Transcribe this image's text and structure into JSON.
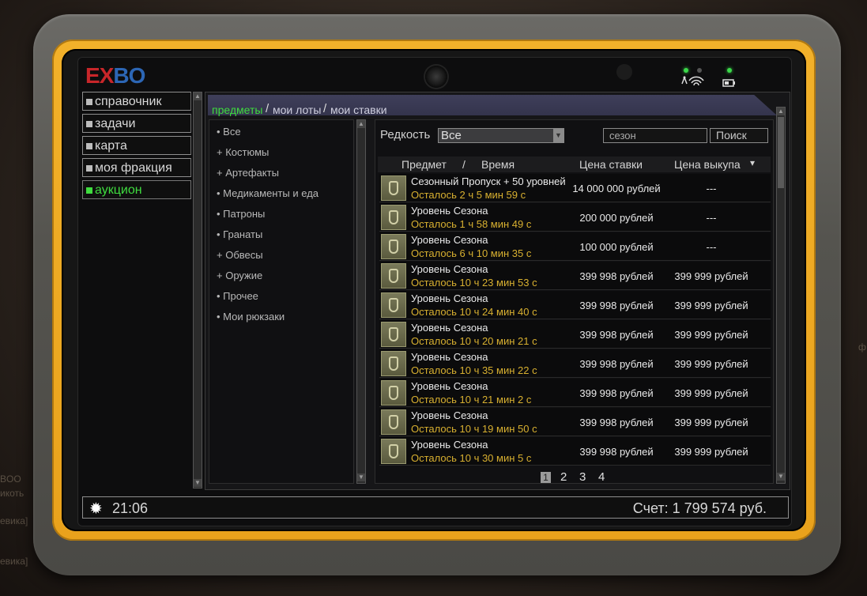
{
  "background_text": [
    "ф",
    "BOO",
    "икоть",
    "евика]",
    "евика]"
  ],
  "logo": {
    "part1": "E",
    "part2": "X",
    "part3": "BO"
  },
  "sidebar": {
    "items": [
      {
        "label": "справочник"
      },
      {
        "label": "задачи"
      },
      {
        "label": "карта"
      },
      {
        "label": "моя фракция"
      },
      {
        "label": "аукцион",
        "active": true
      }
    ]
  },
  "tabs": [
    {
      "label": "предметы",
      "active": true
    },
    {
      "label": "мои лоты"
    },
    {
      "label": "мои ставки"
    }
  ],
  "tab_separator": "/",
  "categories": [
    "• Все",
    "+ Костюмы",
    "+ Артефакты",
    "• Медикаменты и еда",
    "• Патроны",
    "• Гранаты",
    "+ Обвесы",
    "+ Оружие",
    "• Прочее",
    "• Мои рюкзаки"
  ],
  "filter": {
    "rarity_label": "Редкость",
    "rarity_value": "Все",
    "search_value": "сезон",
    "search_button": "Поиск"
  },
  "table": {
    "headers": {
      "item": "Предмет",
      "slash": "/",
      "time": "Время",
      "bid": "Цена ставки",
      "buyout": "Цена выкупа",
      "sort_indicator": "▾"
    },
    "rows": [
      {
        "name": "Сезонный Пропуск + 50 уровней",
        "time": "Осталось 2 ч 5 мин 59 с",
        "bid": "14 000 000 рублей",
        "buyout": "---",
        "icon": "season-pass-icon"
      },
      {
        "name": "Уровень Сезона",
        "time": "Осталось 1 ч 58 мин 49 с",
        "bid": "200 000 рублей",
        "buyout": "---",
        "icon": "season-level-icon"
      },
      {
        "name": "Уровень Сезона",
        "time": "Осталось 6 ч 10 мин 35 с",
        "bid": "100 000 рублей",
        "buyout": "---",
        "icon": "season-level-icon"
      },
      {
        "name": "Уровень Сезона",
        "time": "Осталось 10 ч 23 мин 53 с",
        "bid": "399 998 рублей",
        "buyout": "399 999 рублей",
        "icon": "season-level-icon"
      },
      {
        "name": "Уровень Сезона",
        "time": "Осталось 10 ч 24 мин 40 с",
        "bid": "399 998 рублей",
        "buyout": "399 999 рублей",
        "icon": "season-level-icon"
      },
      {
        "name": "Уровень Сезона",
        "time": "Осталось 10 ч 20 мин 21 с",
        "bid": "399 998 рублей",
        "buyout": "399 999 рублей",
        "icon": "season-level-icon"
      },
      {
        "name": "Уровень Сезона",
        "time": "Осталось 10 ч 35 мин 22 с",
        "bid": "399 998 рублей",
        "buyout": "399 999 рублей",
        "icon": "season-level-icon"
      },
      {
        "name": "Уровень Сезона",
        "time": "Осталось 10 ч 21 мин 2 с",
        "bid": "399 998 рублей",
        "buyout": "399 999 рублей",
        "icon": "season-level-icon"
      },
      {
        "name": "Уровень Сезона",
        "time": "Осталось 10 ч 19 мин 50 с",
        "bid": "399 998 рублей",
        "buyout": "399 999 рублей",
        "icon": "season-level-icon"
      },
      {
        "name": "Уровень Сезона",
        "time": "Осталось 10 ч 30 мин 5 с",
        "bid": "399 998 рублей",
        "buyout": "399 999 рублей",
        "icon": "season-level-icon"
      }
    ]
  },
  "pagination": {
    "pages": [
      "1",
      "2",
      "3",
      "4"
    ],
    "current": "1"
  },
  "footer": {
    "clock": "21:06",
    "account": "Счет: 1 799 574 руб."
  },
  "colors": {
    "accent_green": "#3fdc3f",
    "time_yellow": "#d8b030",
    "frame_yellow": "#f2b12a",
    "tab_bar": "#3f3f5a"
  }
}
